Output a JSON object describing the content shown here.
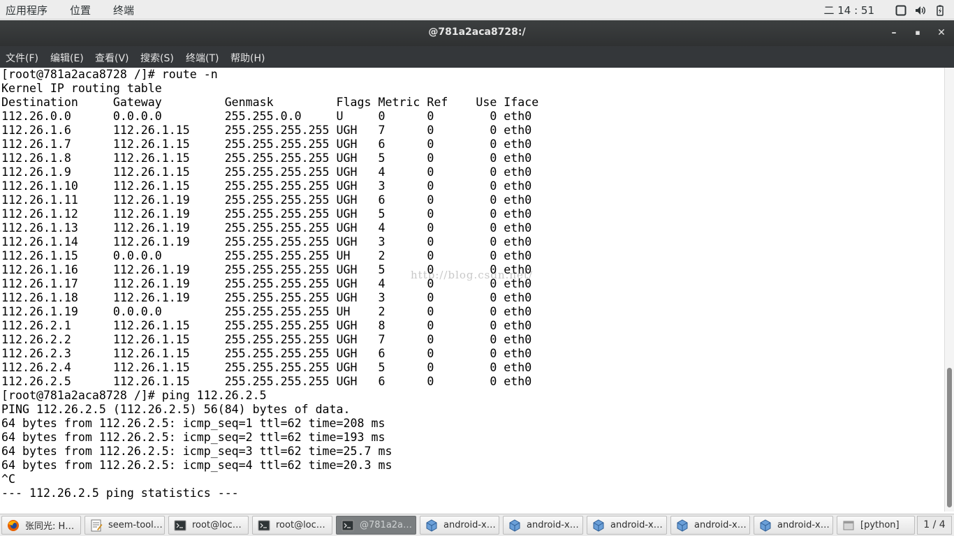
{
  "top_panel": {
    "menu": [
      "应用程序",
      "位置",
      "终端"
    ],
    "clock": "二 14 : 51",
    "tray_icons": [
      "window-icon",
      "volume-icon",
      "battery-icon"
    ]
  },
  "window": {
    "title": "@781a2aca8728:/",
    "controls": {
      "minimize": "–",
      "maximize": "▪",
      "close": "✕"
    }
  },
  "menubar": [
    "文件(F)",
    "编辑(E)",
    "查看(V)",
    "搜索(S)",
    "终端(T)",
    "帮助(H)"
  ],
  "terminal": {
    "lines": [
      "[root@781a2aca8728 /]# route -n",
      "Kernel IP routing table",
      "Destination     Gateway         Genmask         Flags Metric Ref    Use Iface",
      "112.26.0.0      0.0.0.0         255.255.0.0     U     0      0        0 eth0",
      "112.26.1.6      112.26.1.15     255.255.255.255 UGH   7      0        0 eth0",
      "112.26.1.7      112.26.1.15     255.255.255.255 UGH   6      0        0 eth0",
      "112.26.1.8      112.26.1.15     255.255.255.255 UGH   5      0        0 eth0",
      "112.26.1.9      112.26.1.15     255.255.255.255 UGH   4      0        0 eth0",
      "112.26.1.10     112.26.1.15     255.255.255.255 UGH   3      0        0 eth0",
      "112.26.1.11     112.26.1.19     255.255.255.255 UGH   6      0        0 eth0",
      "112.26.1.12     112.26.1.19     255.255.255.255 UGH   5      0        0 eth0",
      "112.26.1.13     112.26.1.19     255.255.255.255 UGH   4      0        0 eth0",
      "112.26.1.14     112.26.1.19     255.255.255.255 UGH   3      0        0 eth0",
      "112.26.1.15     0.0.0.0         255.255.255.255 UH    2      0        0 eth0",
      "112.26.1.16     112.26.1.19     255.255.255.255 UGH   5      0        0 eth0",
      "112.26.1.17     112.26.1.19     255.255.255.255 UGH   4      0        0 eth0",
      "112.26.1.18     112.26.1.19     255.255.255.255 UGH   3      0        0 eth0",
      "112.26.1.19     0.0.0.0         255.255.255.255 UH    2      0        0 eth0",
      "112.26.2.1      112.26.1.15     255.255.255.255 UGH   8      0        0 eth0",
      "112.26.2.2      112.26.1.15     255.255.255.255 UGH   7      0        0 eth0",
      "112.26.2.3      112.26.1.15     255.255.255.255 UGH   6      0        0 eth0",
      "112.26.2.4      112.26.1.15     255.255.255.255 UGH   5      0        0 eth0",
      "112.26.2.5      112.26.1.15     255.255.255.255 UGH   6      0        0 eth0",
      "[root@781a2aca8728 /]# ping 112.26.2.5",
      "PING 112.26.2.5 (112.26.2.5) 56(84) bytes of data.",
      "64 bytes from 112.26.2.5: icmp_seq=1 ttl=62 time=208 ms",
      "64 bytes from 112.26.2.5: icmp_seq=2 ttl=62 time=193 ms",
      "64 bytes from 112.26.2.5: icmp_seq=3 ttl=62 time=25.7 ms",
      "64 bytes from 112.26.2.5: icmp_seq=4 ttl=62 time=20.3 ms",
      "^C",
      "--- 112.26.2.5 ping statistics ---"
    ],
    "watermark": "http://blog.csdn.net/"
  },
  "taskbar": {
    "tasks": [
      {
        "label": "张同光: H…",
        "icon": "firefox-icon",
        "active": false
      },
      {
        "label": "seem-tool…",
        "icon": "text-editor-icon",
        "active": false
      },
      {
        "label": "root@loc…",
        "icon": "terminal-icon",
        "active": false
      },
      {
        "label": "root@loc…",
        "icon": "terminal-icon",
        "active": false
      },
      {
        "label": "@781a2a…",
        "icon": "terminal-icon",
        "active": true
      },
      {
        "label": "android-x…",
        "icon": "virtualbox-icon",
        "active": false
      },
      {
        "label": "android-x…",
        "icon": "virtualbox-icon",
        "active": false
      },
      {
        "label": "android-x…",
        "icon": "virtualbox-icon",
        "active": false
      },
      {
        "label": "android-x…",
        "icon": "virtualbox-icon",
        "active": false
      },
      {
        "label": "android-x…",
        "icon": "virtualbox-icon",
        "active": false
      },
      {
        "label": "[python]",
        "icon": "window-icon",
        "active": false
      }
    ],
    "pager": "1 / 4"
  }
}
